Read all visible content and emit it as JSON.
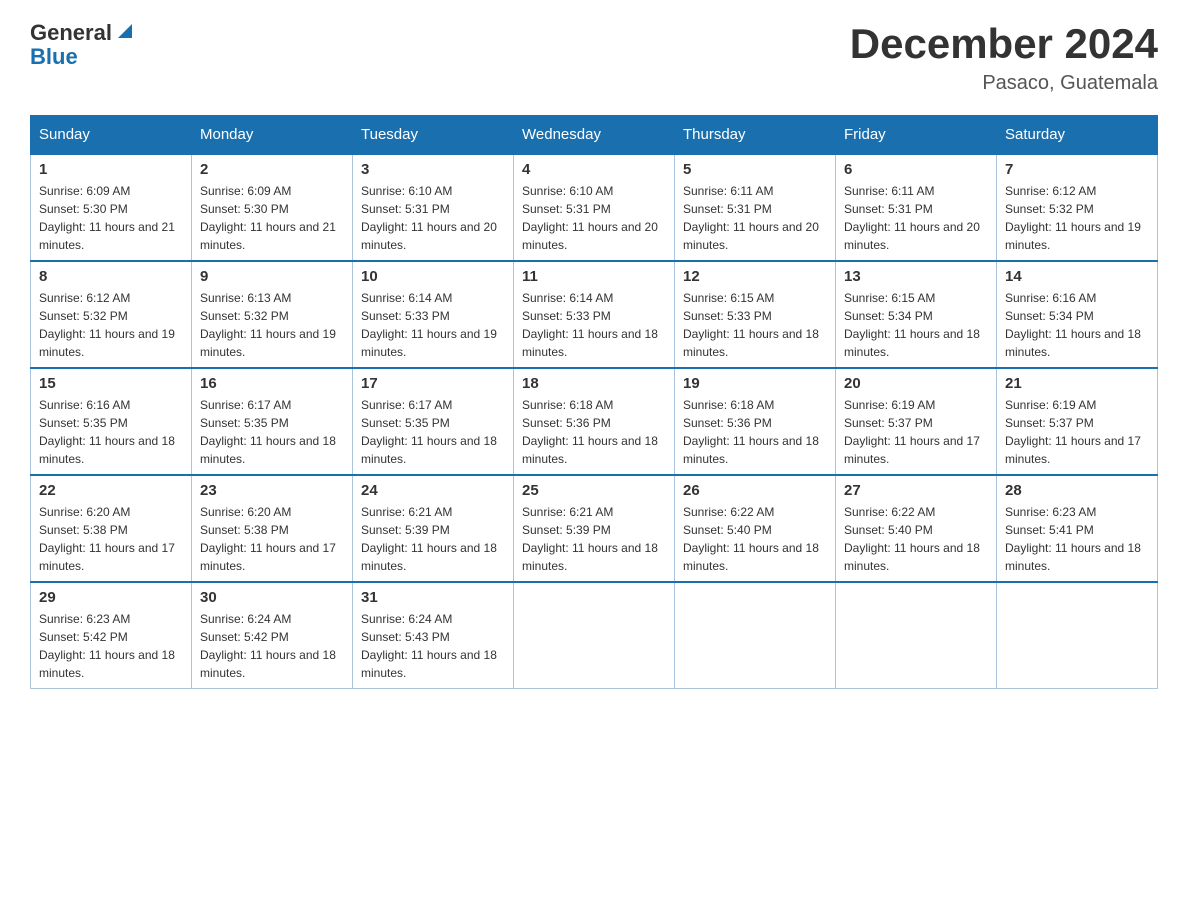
{
  "header": {
    "logo_general": "General",
    "logo_blue": "Blue",
    "month_title": "December 2024",
    "location": "Pasaco, Guatemala"
  },
  "days_of_week": [
    "Sunday",
    "Monday",
    "Tuesday",
    "Wednesday",
    "Thursday",
    "Friday",
    "Saturday"
  ],
  "weeks": [
    [
      {
        "num": "1",
        "sunrise": "6:09 AM",
        "sunset": "5:30 PM",
        "daylight": "11 hours and 21 minutes."
      },
      {
        "num": "2",
        "sunrise": "6:09 AM",
        "sunset": "5:30 PM",
        "daylight": "11 hours and 21 minutes."
      },
      {
        "num": "3",
        "sunrise": "6:10 AM",
        "sunset": "5:31 PM",
        "daylight": "11 hours and 20 minutes."
      },
      {
        "num": "4",
        "sunrise": "6:10 AM",
        "sunset": "5:31 PM",
        "daylight": "11 hours and 20 minutes."
      },
      {
        "num": "5",
        "sunrise": "6:11 AM",
        "sunset": "5:31 PM",
        "daylight": "11 hours and 20 minutes."
      },
      {
        "num": "6",
        "sunrise": "6:11 AM",
        "sunset": "5:31 PM",
        "daylight": "11 hours and 20 minutes."
      },
      {
        "num": "7",
        "sunrise": "6:12 AM",
        "sunset": "5:32 PM",
        "daylight": "11 hours and 19 minutes."
      }
    ],
    [
      {
        "num": "8",
        "sunrise": "6:12 AM",
        "sunset": "5:32 PM",
        "daylight": "11 hours and 19 minutes."
      },
      {
        "num": "9",
        "sunrise": "6:13 AM",
        "sunset": "5:32 PM",
        "daylight": "11 hours and 19 minutes."
      },
      {
        "num": "10",
        "sunrise": "6:14 AM",
        "sunset": "5:33 PM",
        "daylight": "11 hours and 19 minutes."
      },
      {
        "num": "11",
        "sunrise": "6:14 AM",
        "sunset": "5:33 PM",
        "daylight": "11 hours and 18 minutes."
      },
      {
        "num": "12",
        "sunrise": "6:15 AM",
        "sunset": "5:33 PM",
        "daylight": "11 hours and 18 minutes."
      },
      {
        "num": "13",
        "sunrise": "6:15 AM",
        "sunset": "5:34 PM",
        "daylight": "11 hours and 18 minutes."
      },
      {
        "num": "14",
        "sunrise": "6:16 AM",
        "sunset": "5:34 PM",
        "daylight": "11 hours and 18 minutes."
      }
    ],
    [
      {
        "num": "15",
        "sunrise": "6:16 AM",
        "sunset": "5:35 PM",
        "daylight": "11 hours and 18 minutes."
      },
      {
        "num": "16",
        "sunrise": "6:17 AM",
        "sunset": "5:35 PM",
        "daylight": "11 hours and 18 minutes."
      },
      {
        "num": "17",
        "sunrise": "6:17 AM",
        "sunset": "5:35 PM",
        "daylight": "11 hours and 18 minutes."
      },
      {
        "num": "18",
        "sunrise": "6:18 AM",
        "sunset": "5:36 PM",
        "daylight": "11 hours and 18 minutes."
      },
      {
        "num": "19",
        "sunrise": "6:18 AM",
        "sunset": "5:36 PM",
        "daylight": "11 hours and 18 minutes."
      },
      {
        "num": "20",
        "sunrise": "6:19 AM",
        "sunset": "5:37 PM",
        "daylight": "11 hours and 17 minutes."
      },
      {
        "num": "21",
        "sunrise": "6:19 AM",
        "sunset": "5:37 PM",
        "daylight": "11 hours and 17 minutes."
      }
    ],
    [
      {
        "num": "22",
        "sunrise": "6:20 AM",
        "sunset": "5:38 PM",
        "daylight": "11 hours and 17 minutes."
      },
      {
        "num": "23",
        "sunrise": "6:20 AM",
        "sunset": "5:38 PM",
        "daylight": "11 hours and 17 minutes."
      },
      {
        "num": "24",
        "sunrise": "6:21 AM",
        "sunset": "5:39 PM",
        "daylight": "11 hours and 18 minutes."
      },
      {
        "num": "25",
        "sunrise": "6:21 AM",
        "sunset": "5:39 PM",
        "daylight": "11 hours and 18 minutes."
      },
      {
        "num": "26",
        "sunrise": "6:22 AM",
        "sunset": "5:40 PM",
        "daylight": "11 hours and 18 minutes."
      },
      {
        "num": "27",
        "sunrise": "6:22 AM",
        "sunset": "5:40 PM",
        "daylight": "11 hours and 18 minutes."
      },
      {
        "num": "28",
        "sunrise": "6:23 AM",
        "sunset": "5:41 PM",
        "daylight": "11 hours and 18 minutes."
      }
    ],
    [
      {
        "num": "29",
        "sunrise": "6:23 AM",
        "sunset": "5:42 PM",
        "daylight": "11 hours and 18 minutes."
      },
      {
        "num": "30",
        "sunrise": "6:24 AM",
        "sunset": "5:42 PM",
        "daylight": "11 hours and 18 minutes."
      },
      {
        "num": "31",
        "sunrise": "6:24 AM",
        "sunset": "5:43 PM",
        "daylight": "11 hours and 18 minutes."
      },
      null,
      null,
      null,
      null
    ]
  ]
}
